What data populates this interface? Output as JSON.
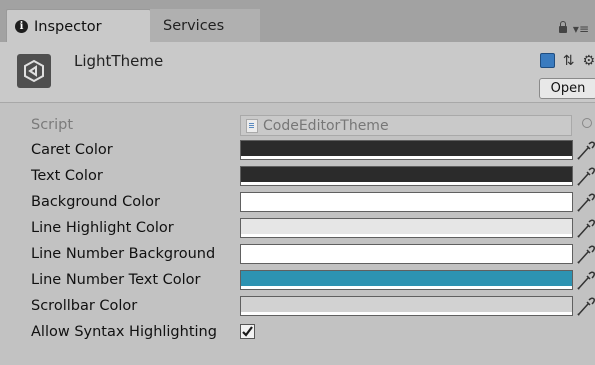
{
  "tabs": [
    {
      "label": "Inspector",
      "icon": "info-icon",
      "active": true
    },
    {
      "label": "Services",
      "active": false
    }
  ],
  "window_icons": {
    "lock": "lock-icon",
    "menu": "▾≡"
  },
  "asset": {
    "name": "LightTheme",
    "icon": "unity-logo-icon"
  },
  "header_icons": [
    "book-icon",
    "preset-icon",
    "gear-icon"
  ],
  "open_label": "Open",
  "script": {
    "label": "Script",
    "value": "CodeEditorTheme"
  },
  "properties": [
    {
      "label": "Caret Color",
      "color": "#2b2b2b"
    },
    {
      "label": "Text Color",
      "color": "#2b2b2b"
    },
    {
      "label": "Background Color",
      "color": "#ffffff"
    },
    {
      "label": "Line Highlight Color",
      "color": "#e6e6e6"
    },
    {
      "label": "Line Number Background",
      "color": "#ffffff"
    },
    {
      "label": "Line Number Text Color",
      "color": "#2d93b2"
    },
    {
      "label": "Scrollbar Color",
      "color": "#d2d2d2"
    }
  ],
  "syntax_highlighting": {
    "label": "Allow Syntax Highlighting",
    "checked": true
  }
}
